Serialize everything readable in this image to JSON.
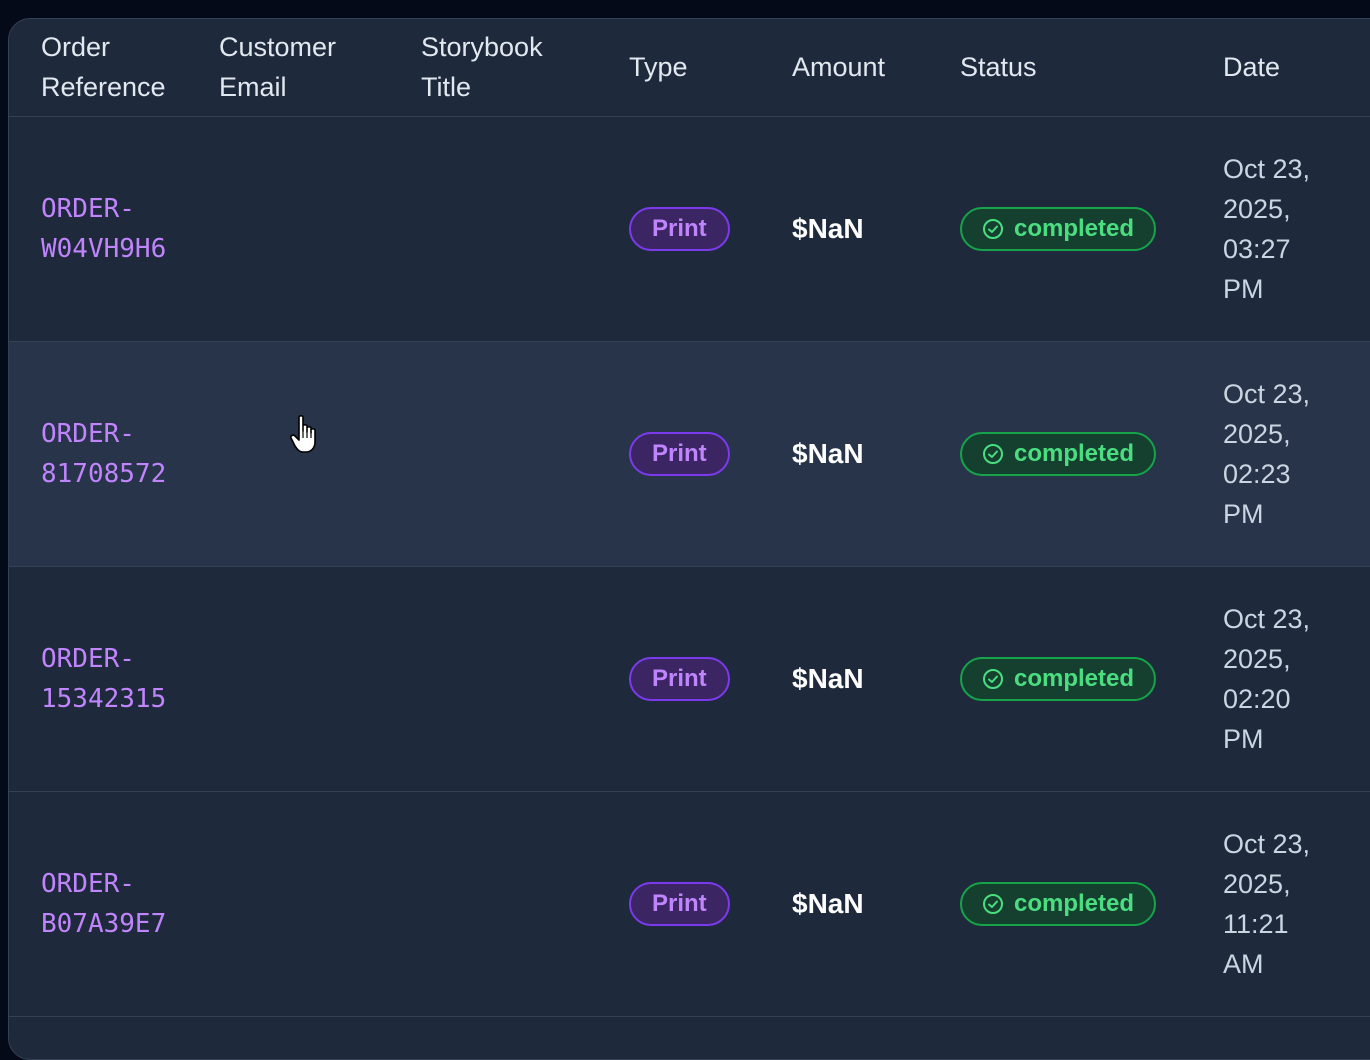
{
  "table": {
    "headers": {
      "order_reference": "Order\nReference",
      "customer_email": "Customer\nEmail",
      "storybook_title": "Storybook\nTitle",
      "type": "Type",
      "amount": "Amount",
      "status": "Status",
      "date": "Date"
    },
    "rows": [
      {
        "ref": "ORDER-\nW04VH9H6",
        "email": "",
        "title": "",
        "type": "Print",
        "amount": "$NaN",
        "status": "completed",
        "date": "Oct 23,\n2025,\n03:27\nPM"
      },
      {
        "ref": "ORDER-\n81708572",
        "email": "",
        "title": "",
        "type": "Print",
        "amount": "$NaN",
        "status": "completed",
        "date": "Oct 23,\n2025,\n02:23\nPM"
      },
      {
        "ref": "ORDER-\n15342315",
        "email": "",
        "title": "",
        "type": "Print",
        "amount": "$NaN",
        "status": "completed",
        "date": "Oct 23,\n2025,\n02:20\nPM"
      },
      {
        "ref": "ORDER-\nB07A39E7",
        "email": "",
        "title": "",
        "type": "Print",
        "amount": "$NaN",
        "status": "completed",
        "date": "Oct 23,\n2025,\n11:21\nAM"
      }
    ]
  },
  "colors": {
    "background": "#050a18",
    "panel": "#1e293b",
    "row_hover": "#27344a",
    "accent_purple": "#c084fc",
    "status_green": "#4ade80"
  },
  "icons": {
    "status": "check-circle-icon",
    "cursor": "hand-pointer-icon"
  }
}
